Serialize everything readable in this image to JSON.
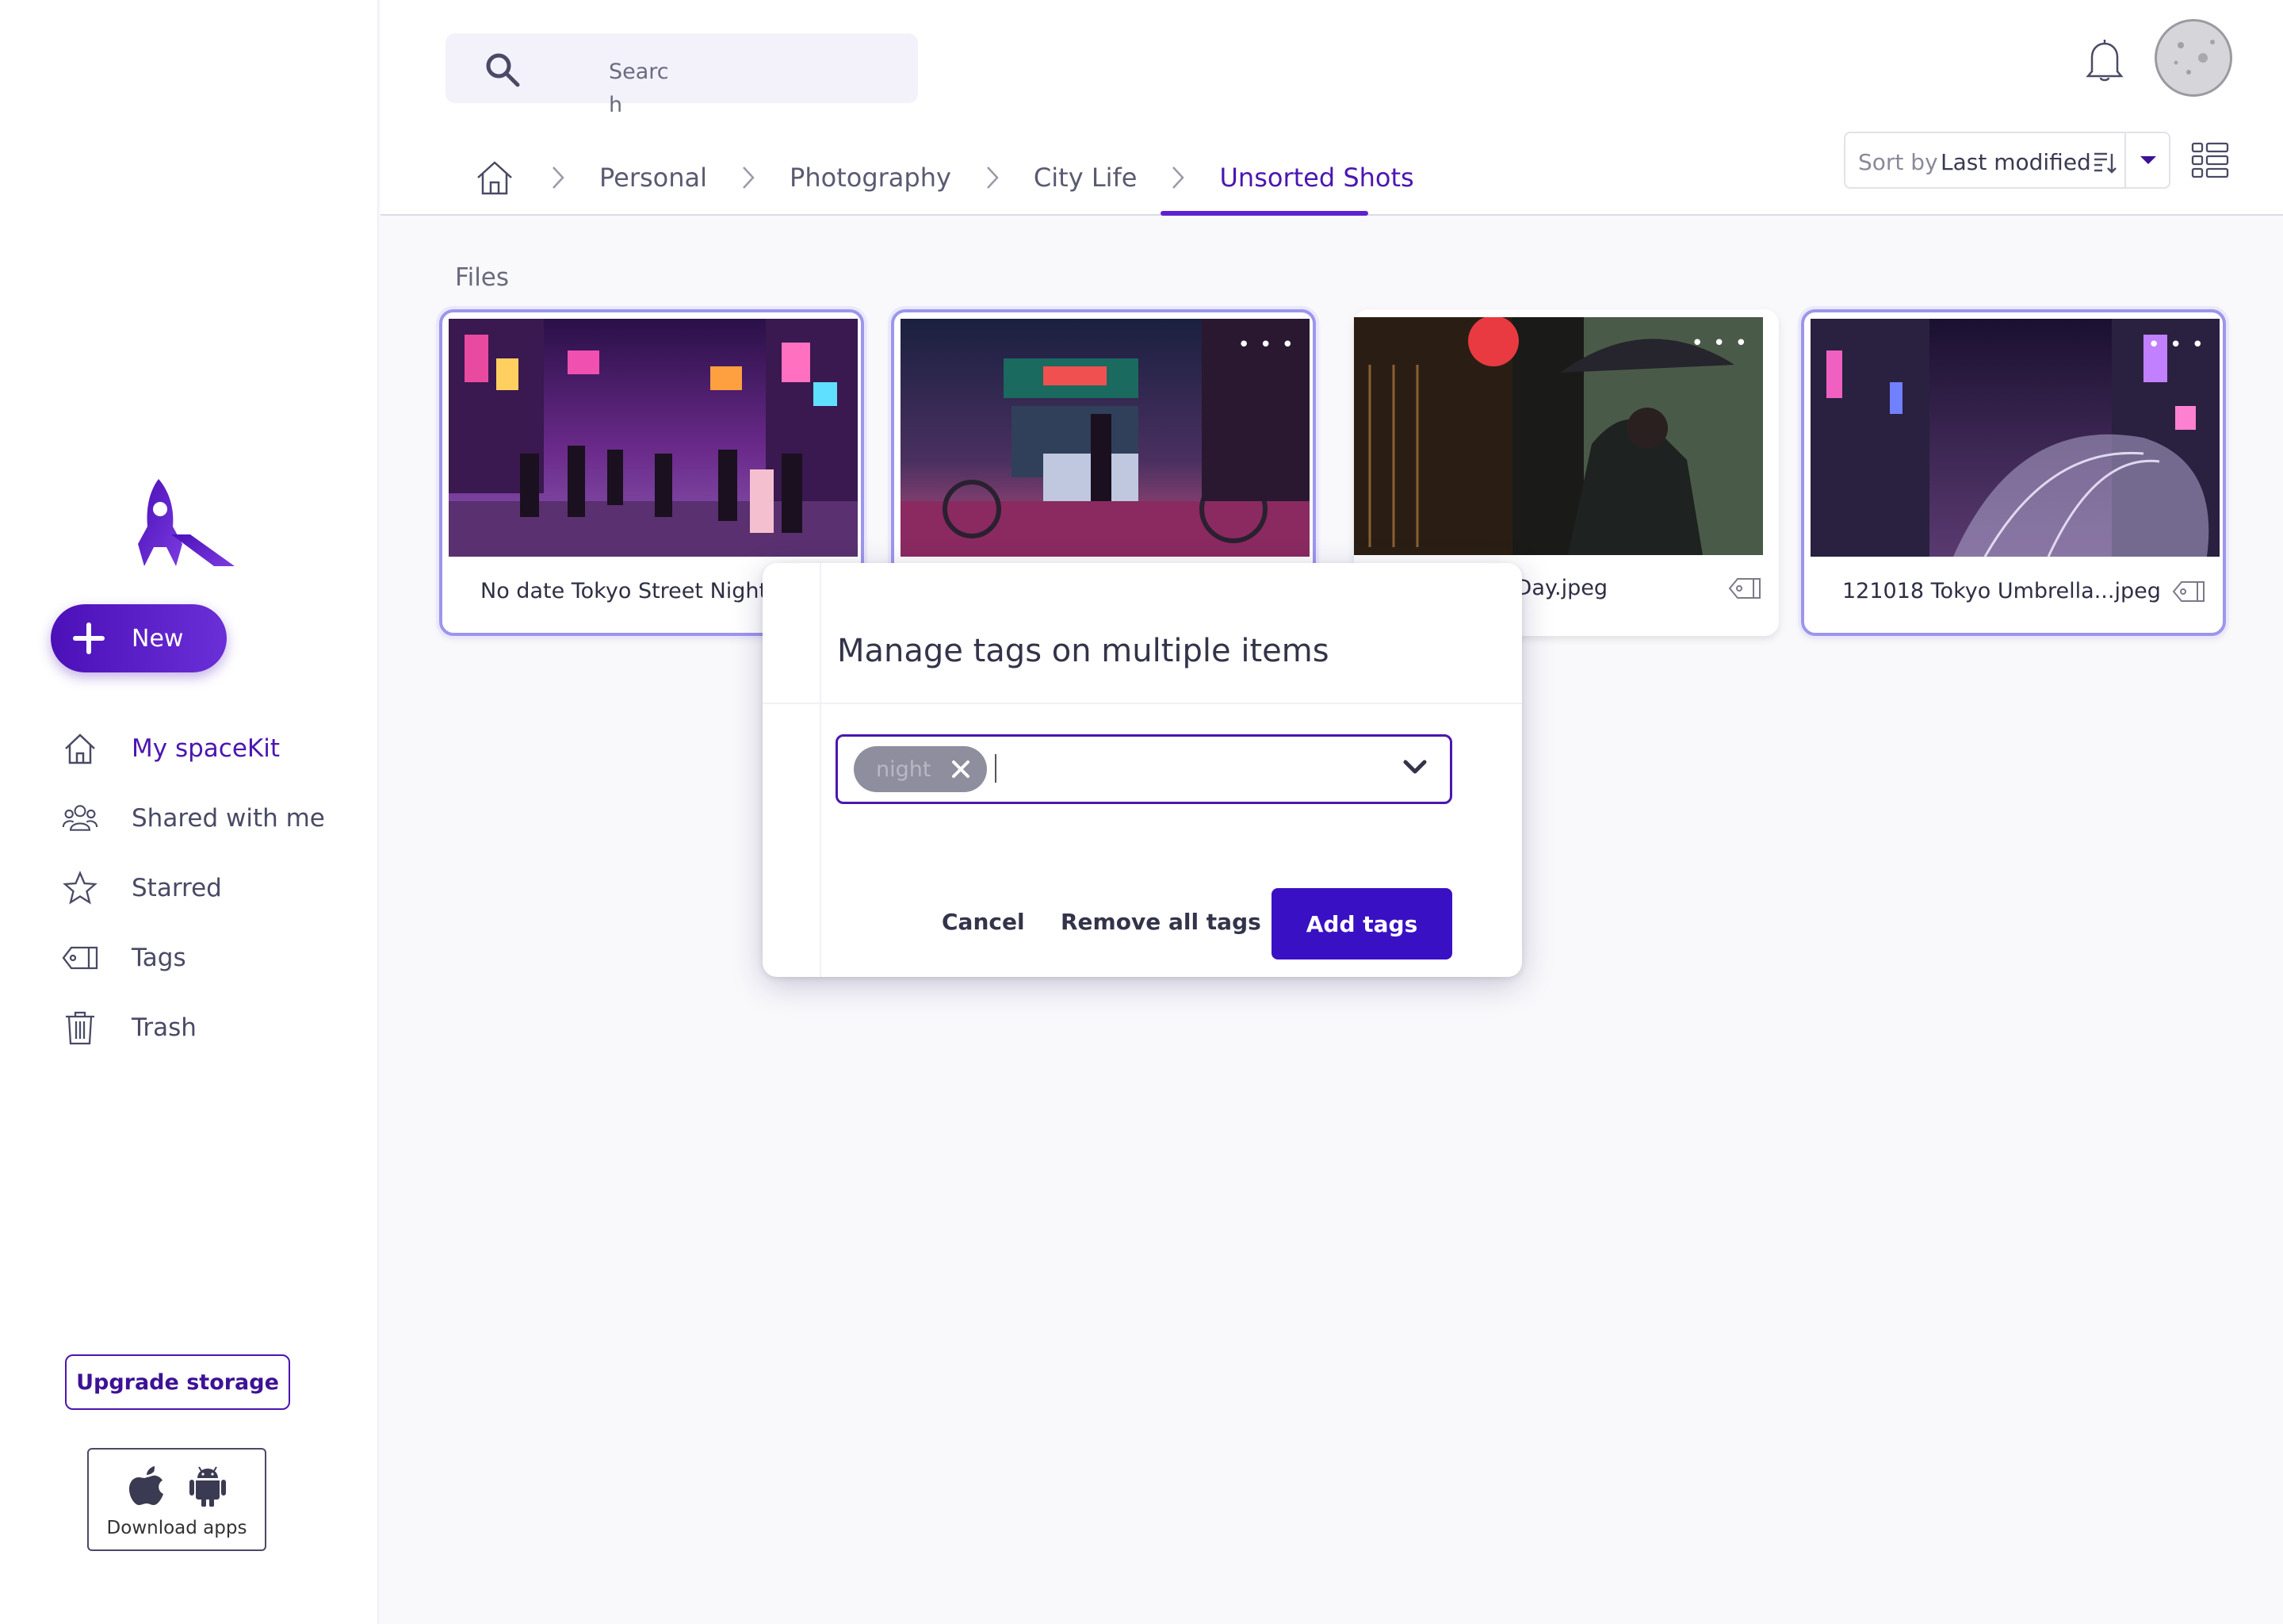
{
  "sidebar": {
    "new_label": "New",
    "nav": [
      {
        "label": "My spaceKit",
        "icon": "home-icon",
        "active": true
      },
      {
        "label": "Shared with me",
        "icon": "people-icon",
        "active": false
      },
      {
        "label": "Starred",
        "icon": "star-icon",
        "active": false
      },
      {
        "label": "Tags",
        "icon": "tag-icon",
        "active": false
      },
      {
        "label": "Trash",
        "icon": "trash-icon",
        "active": false
      }
    ],
    "upgrade_label": "Upgrade storage",
    "download_label": "Download apps"
  },
  "search": {
    "placeholder": "Search"
  },
  "breadcrumb": [
    "Personal",
    "Photography",
    "City Life",
    "Unsorted Shots"
  ],
  "sort": {
    "prefix": "Sort by",
    "value": "Last modified"
  },
  "files_label": "Files",
  "files": [
    {
      "name": "No date Tokyo Street Night.jp",
      "selected": true
    },
    {
      "name": "",
      "selected": true
    },
    {
      "name": "o Umbrella Day.jpeg",
      "selected": false
    },
    {
      "name": "121018 Tokyo Umbrella...jpeg",
      "selected": true
    }
  ],
  "modal": {
    "title": "Manage tags on multiple items",
    "tags": [
      "night"
    ],
    "cancel_label": "Cancel",
    "remove_label": "Remove all tags",
    "add_label": "Add tags"
  },
  "colors": {
    "accent": "#4b16b0",
    "primary_button": "#3a10c4"
  }
}
